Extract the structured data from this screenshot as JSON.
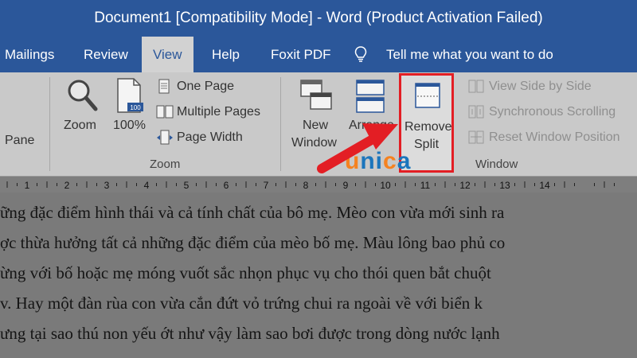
{
  "window": {
    "title": "Document1 [Compatibility Mode]  -  Word (Product Activation Failed)"
  },
  "tabs": [
    {
      "label": "Mailings"
    },
    {
      "label": "Review"
    },
    {
      "label": "View",
      "active": true
    },
    {
      "label": "Help"
    },
    {
      "label": "Foxit PDF"
    }
  ],
  "tell_me": {
    "text": "Tell me what you want to do",
    "icon": "lightbulb-icon"
  },
  "ribbon": {
    "pane_label": "Pane",
    "zoom_group": {
      "label": "Zoom",
      "zoom_button": "Zoom",
      "hundred_button": "100%",
      "hundred_badge": "100",
      "one_page": "One Page",
      "multiple_pages": "Multiple Pages",
      "page_width": "Page Width"
    },
    "window_group": {
      "label": "Window",
      "new_window": [
        "New",
        "Window"
      ],
      "arrange_all": "Arrange",
      "remove_split": [
        "Remove",
        "Split"
      ],
      "view_side_by_side": "View Side by Side",
      "synchronous_scrolling": "Synchronous Scrolling",
      "reset_window_position": "Reset Window Position"
    }
  },
  "ruler": {
    "numbers": [
      "1",
      "2",
      "3",
      "4",
      "5",
      "6",
      "7",
      "8",
      "9",
      "10",
      "11",
      "12",
      "13",
      "14"
    ]
  },
  "watermark": {
    "text": "unica",
    "colors": [
      "#f58220",
      "#1b75bc"
    ]
  },
  "document": {
    "lines": [
      "ững đặc điểm hình thái và cả tính chất của bô mẹ. Mèo con vừa mới sinh ra",
      "ợc thừa hưởng tất cả những đặc điểm của mèo bố mẹ. Màu lông bao phủ co",
      "ừng với bố hoặc mẹ móng vuốt sắc nhọn phục vụ cho thói quen bắt chuột",
      "v. Hay một đàn rùa con vừa cắn đứt vỏ trứng chui ra ngoài về với biển k",
      "ưng tại sao thú non yếu ớt như vậy làm sao bơi được trong dòng nước lạnh"
    ]
  },
  "colors": {
    "title_bar": "#2b579a",
    "highlight": "#e31e24",
    "arrow": "#e31e24"
  }
}
